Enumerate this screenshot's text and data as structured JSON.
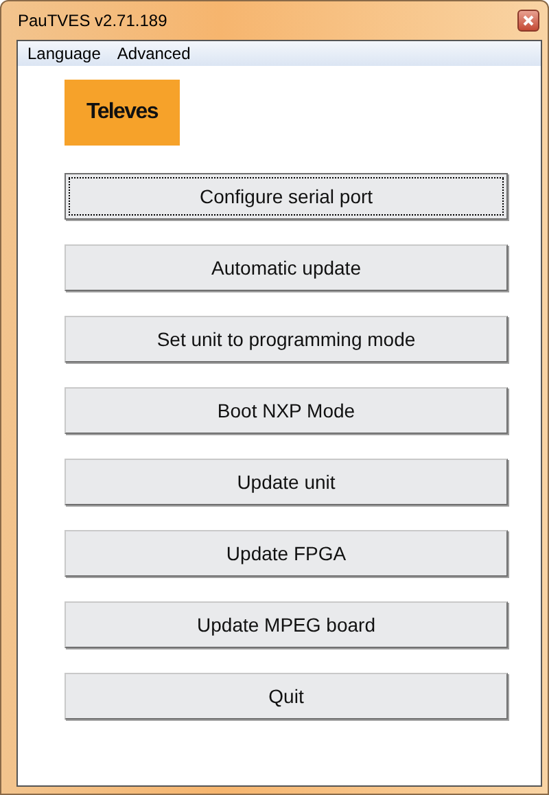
{
  "window": {
    "title": "PauTVES v2.71.189"
  },
  "menu": [
    "Language",
    "Advanced"
  ],
  "logo": {
    "text": "Televes"
  },
  "buttons": [
    {
      "label": "Configure serial port",
      "focused": true
    },
    {
      "label": "Automatic update",
      "focused": false
    },
    {
      "label": "Set unit to programming mode",
      "focused": false
    },
    {
      "label": "Boot NXP Mode",
      "focused": false
    },
    {
      "label": "Update unit",
      "focused": false
    },
    {
      "label": "Update FPGA",
      "focused": false
    },
    {
      "label": "Update MPEG board",
      "focused": false
    },
    {
      "label": "Quit",
      "focused": false
    }
  ]
}
